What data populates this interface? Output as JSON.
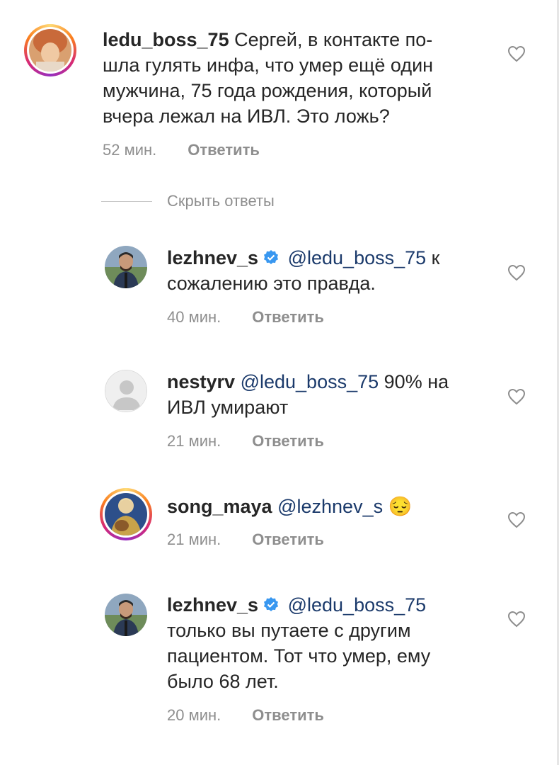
{
  "comments": [
    {
      "username": "ledu_boss_75",
      "lines": [
        "Сергей, в контакте по-",
        "шла гулять инфа, что умер ещё один",
        "мужчина, 75 года рождения, который",
        "вчера лежал на ИВЛ. Это ложь?"
      ],
      "time": "52 мин.",
      "reply": "Ответить"
    },
    {
      "username": "lezhnev_s",
      "mention": "@ledu_boss_75",
      "line1_rest": "к",
      "line2": "сожалению это правда.",
      "time": "40 мин.",
      "reply": "Ответить"
    },
    {
      "username": "nestyrv",
      "mention": "@ledu_boss_75",
      "line1_rest": "90% на",
      "line2": "ИВЛ умирают",
      "time": "21 мин.",
      "reply": "Ответить"
    },
    {
      "username": "song_maya",
      "mention": "@lezhnev_s",
      "emoji": "😔",
      "time": "21 мин.",
      "reply": "Ответить"
    },
    {
      "username": "lezhnev_s",
      "mention": "@ledu_boss_75",
      "line2": "только вы путаете с другим",
      "line3": "пациентом. Тот что умер, ему",
      "line4": "было 68 лет.",
      "time": "20 мин.",
      "reply": "Ответить"
    }
  ],
  "hide_replies_label": "Скрыть ответы",
  "colors": {
    "mention": "#1b3a6b",
    "muted": "#8e8e8e",
    "verified": "#3897f0"
  }
}
